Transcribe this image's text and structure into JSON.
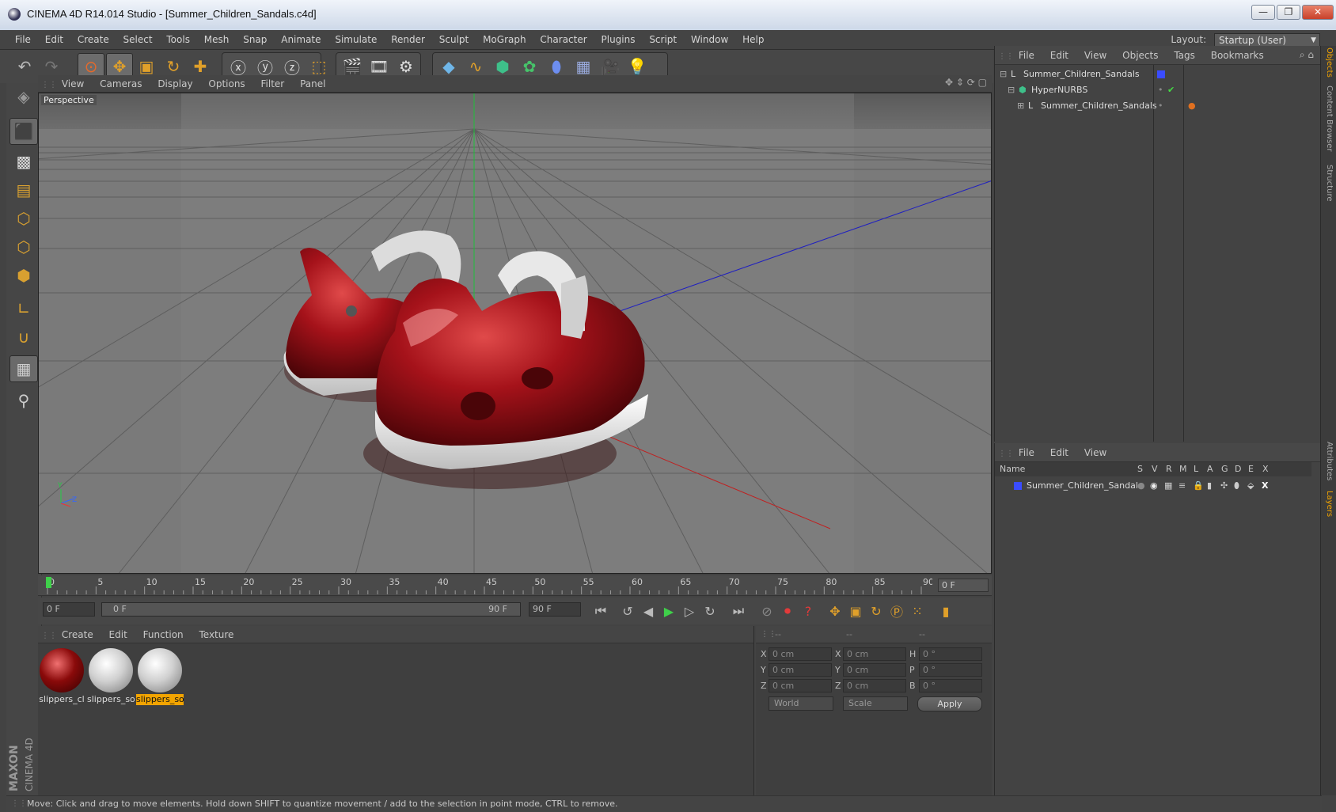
{
  "window": {
    "title": "CINEMA 4D R14.014 Studio - [Summer_Children_Sandals.c4d]",
    "minimize": "—",
    "restore": "❐",
    "close": "✕"
  },
  "menu": [
    "File",
    "Edit",
    "Create",
    "Select",
    "Tools",
    "Mesh",
    "Snap",
    "Animate",
    "Simulate",
    "Render",
    "Sculpt",
    "MoGraph",
    "Character",
    "Plugins",
    "Script",
    "Window",
    "Help"
  ],
  "layout": {
    "label": "Layout:",
    "value": "Startup (User)"
  },
  "viewport": {
    "menu": [
      "View",
      "Cameras",
      "Display",
      "Options",
      "Filter",
      "Panel"
    ],
    "label": "Perspective",
    "axis_y": "Y",
    "axis_z": "Z"
  },
  "timeline": {
    "ticks": [
      "0",
      "5",
      "10",
      "15",
      "20",
      "25",
      "30",
      "35",
      "40",
      "45",
      "50",
      "55",
      "60",
      "65",
      "70",
      "75",
      "80",
      "85",
      "90"
    ],
    "current_frame": "0 F"
  },
  "transport": {
    "start_field": "0 F",
    "range_start": "0 F",
    "range_end": "90 F",
    "end_field": "90 F"
  },
  "materials": {
    "menu": [
      "Create",
      "Edit",
      "Function",
      "Texture"
    ],
    "items": [
      {
        "label": "slippers_cl",
        "color": "#8a0a0a",
        "selected": false
      },
      {
        "label": "slippers_so",
        "color": "#d8d8d8",
        "selected": false
      },
      {
        "label": "slippers_so",
        "color": "#d8d8d8",
        "selected": true
      }
    ]
  },
  "coords": {
    "headers": [
      "--",
      "--",
      "--"
    ],
    "rows": [
      {
        "a": "X",
        "av": "0 cm",
        "b": "X",
        "bv": "0 cm",
        "c": "H",
        "cv": "0 °"
      },
      {
        "a": "Y",
        "av": "0 cm",
        "b": "Y",
        "bv": "0 cm",
        "c": "P",
        "cv": "0 °"
      },
      {
        "a": "Z",
        "av": "0 cm",
        "b": "Z",
        "bv": "0 cm",
        "c": "B",
        "cv": "0 °"
      }
    ],
    "mode": "World",
    "scale": "Scale",
    "apply": "Apply"
  },
  "status": "Move: Click and drag to move elements. Hold down SHIFT to quantize movement / add to the selection in point mode, CTRL to remove.",
  "objects": {
    "menu": [
      "File",
      "Edit",
      "View",
      "Objects",
      "Tags",
      "Bookmarks"
    ],
    "tree": [
      {
        "name": "Summer_Children_Sandals",
        "depth": 0
      },
      {
        "name": "HyperNURBS",
        "depth": 1
      },
      {
        "name": "Summer_Children_Sandals",
        "depth": 2
      }
    ]
  },
  "layers": {
    "menu": [
      "File",
      "Edit",
      "View"
    ],
    "columns": [
      "Name",
      "S",
      "V",
      "R",
      "M",
      "L",
      "A",
      "G",
      "D",
      "E",
      "X"
    ],
    "rows": [
      {
        "name": "Summer_Children_Sandals"
      }
    ]
  },
  "right_tabs": [
    "Objects",
    "Content Browser",
    "Structure",
    "Attributes",
    "Layers"
  ],
  "branding": {
    "line1": "MAXON",
    "line2": "CINEMA 4D"
  },
  "colors": {
    "accent": "#f2a400",
    "sandal": "#9a0d12",
    "sole": "#e8e8e8",
    "layer_blue": "#3a4cff"
  }
}
